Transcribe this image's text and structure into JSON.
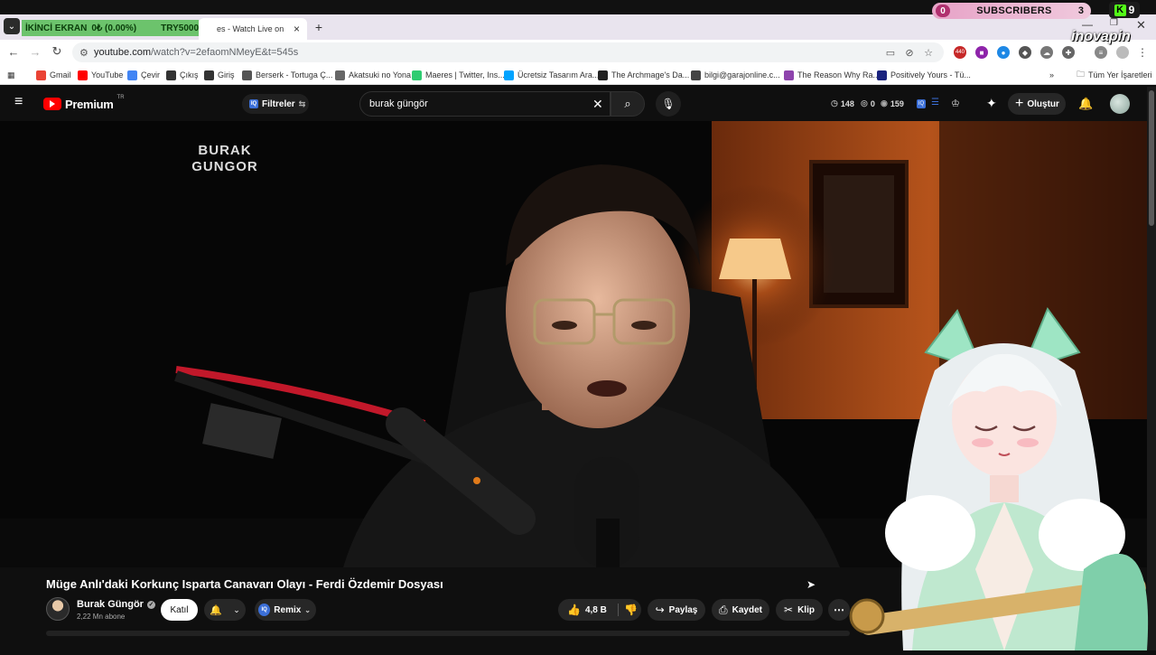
{
  "overlay": {
    "subscribers_lead": "0",
    "subscribers_label": "SUBSCRIBERS",
    "subscribers_count": "3",
    "kick_count": "9",
    "stream_banner": [
      "İKİNCİ EKRAN",
      "0₺ (0.00%)",
      "TRY5000"
    ],
    "inovapin": "inovapin"
  },
  "browser": {
    "tab_title": "es - Watch Live on",
    "url_host": "youtube.com",
    "url_rest": "/watch?v=2efaomNMeyE&t=545s",
    "bookmarks": [
      {
        "label": "Gmail",
        "color": "#ea4335"
      },
      {
        "label": "YouTube",
        "color": "#ff0000"
      },
      {
        "label": "Çevir",
        "color": "#4285f4"
      },
      {
        "label": "Çıkış",
        "color": "#333333"
      },
      {
        "label": "Giriş",
        "color": "#333333"
      },
      {
        "label": "Berserk - Tortuga Ç...",
        "color": "#555555"
      },
      {
        "label": "Akatsuki no Yona",
        "color": "#666666"
      },
      {
        "label": "Maeres | Twitter, Ins...",
        "color": "#2ecc71"
      },
      {
        "label": "Ücretsiz Tasarım Ara...",
        "color": "#00a3ff"
      },
      {
        "label": "The Archmage's Da...",
        "color": "#222222"
      },
      {
        "label": "bilgi@garajonline.c...",
        "color": "#444444"
      },
      {
        "label": "The Reason Why Ra...",
        "color": "#8e44ad"
      },
      {
        "label": "Positively Yours - Tü...",
        "color": "#1a237e"
      }
    ],
    "all_bookmarks": "Tüm Yer İşaretleri",
    "ext_badge": "440"
  },
  "youtube": {
    "logo_text": "Premium",
    "logo_region": "TR",
    "filters_label": "Filtreler",
    "search_value": "burak güngör",
    "stats": [
      {
        "icon": "◷",
        "value": "148"
      },
      {
        "icon": "◎",
        "value": "0"
      },
      {
        "icon": "◉",
        "value": "159"
      }
    ],
    "create_label": "Oluştur"
  },
  "video": {
    "watermark": "BURAK GUNGOR",
    "title": "Müge Anlı'daki Korkunç Isparta Canavarı Olayı - Ferdi Özdemir Dosyası",
    "channel": "Burak Güngör",
    "subs": "2,22 Mn abone",
    "join_label": "Katıl",
    "remix_label": "Remix",
    "likes": "4,8 B",
    "share_label": "Paylaş",
    "save_label": "Kaydet",
    "clip_label": "Klip"
  }
}
